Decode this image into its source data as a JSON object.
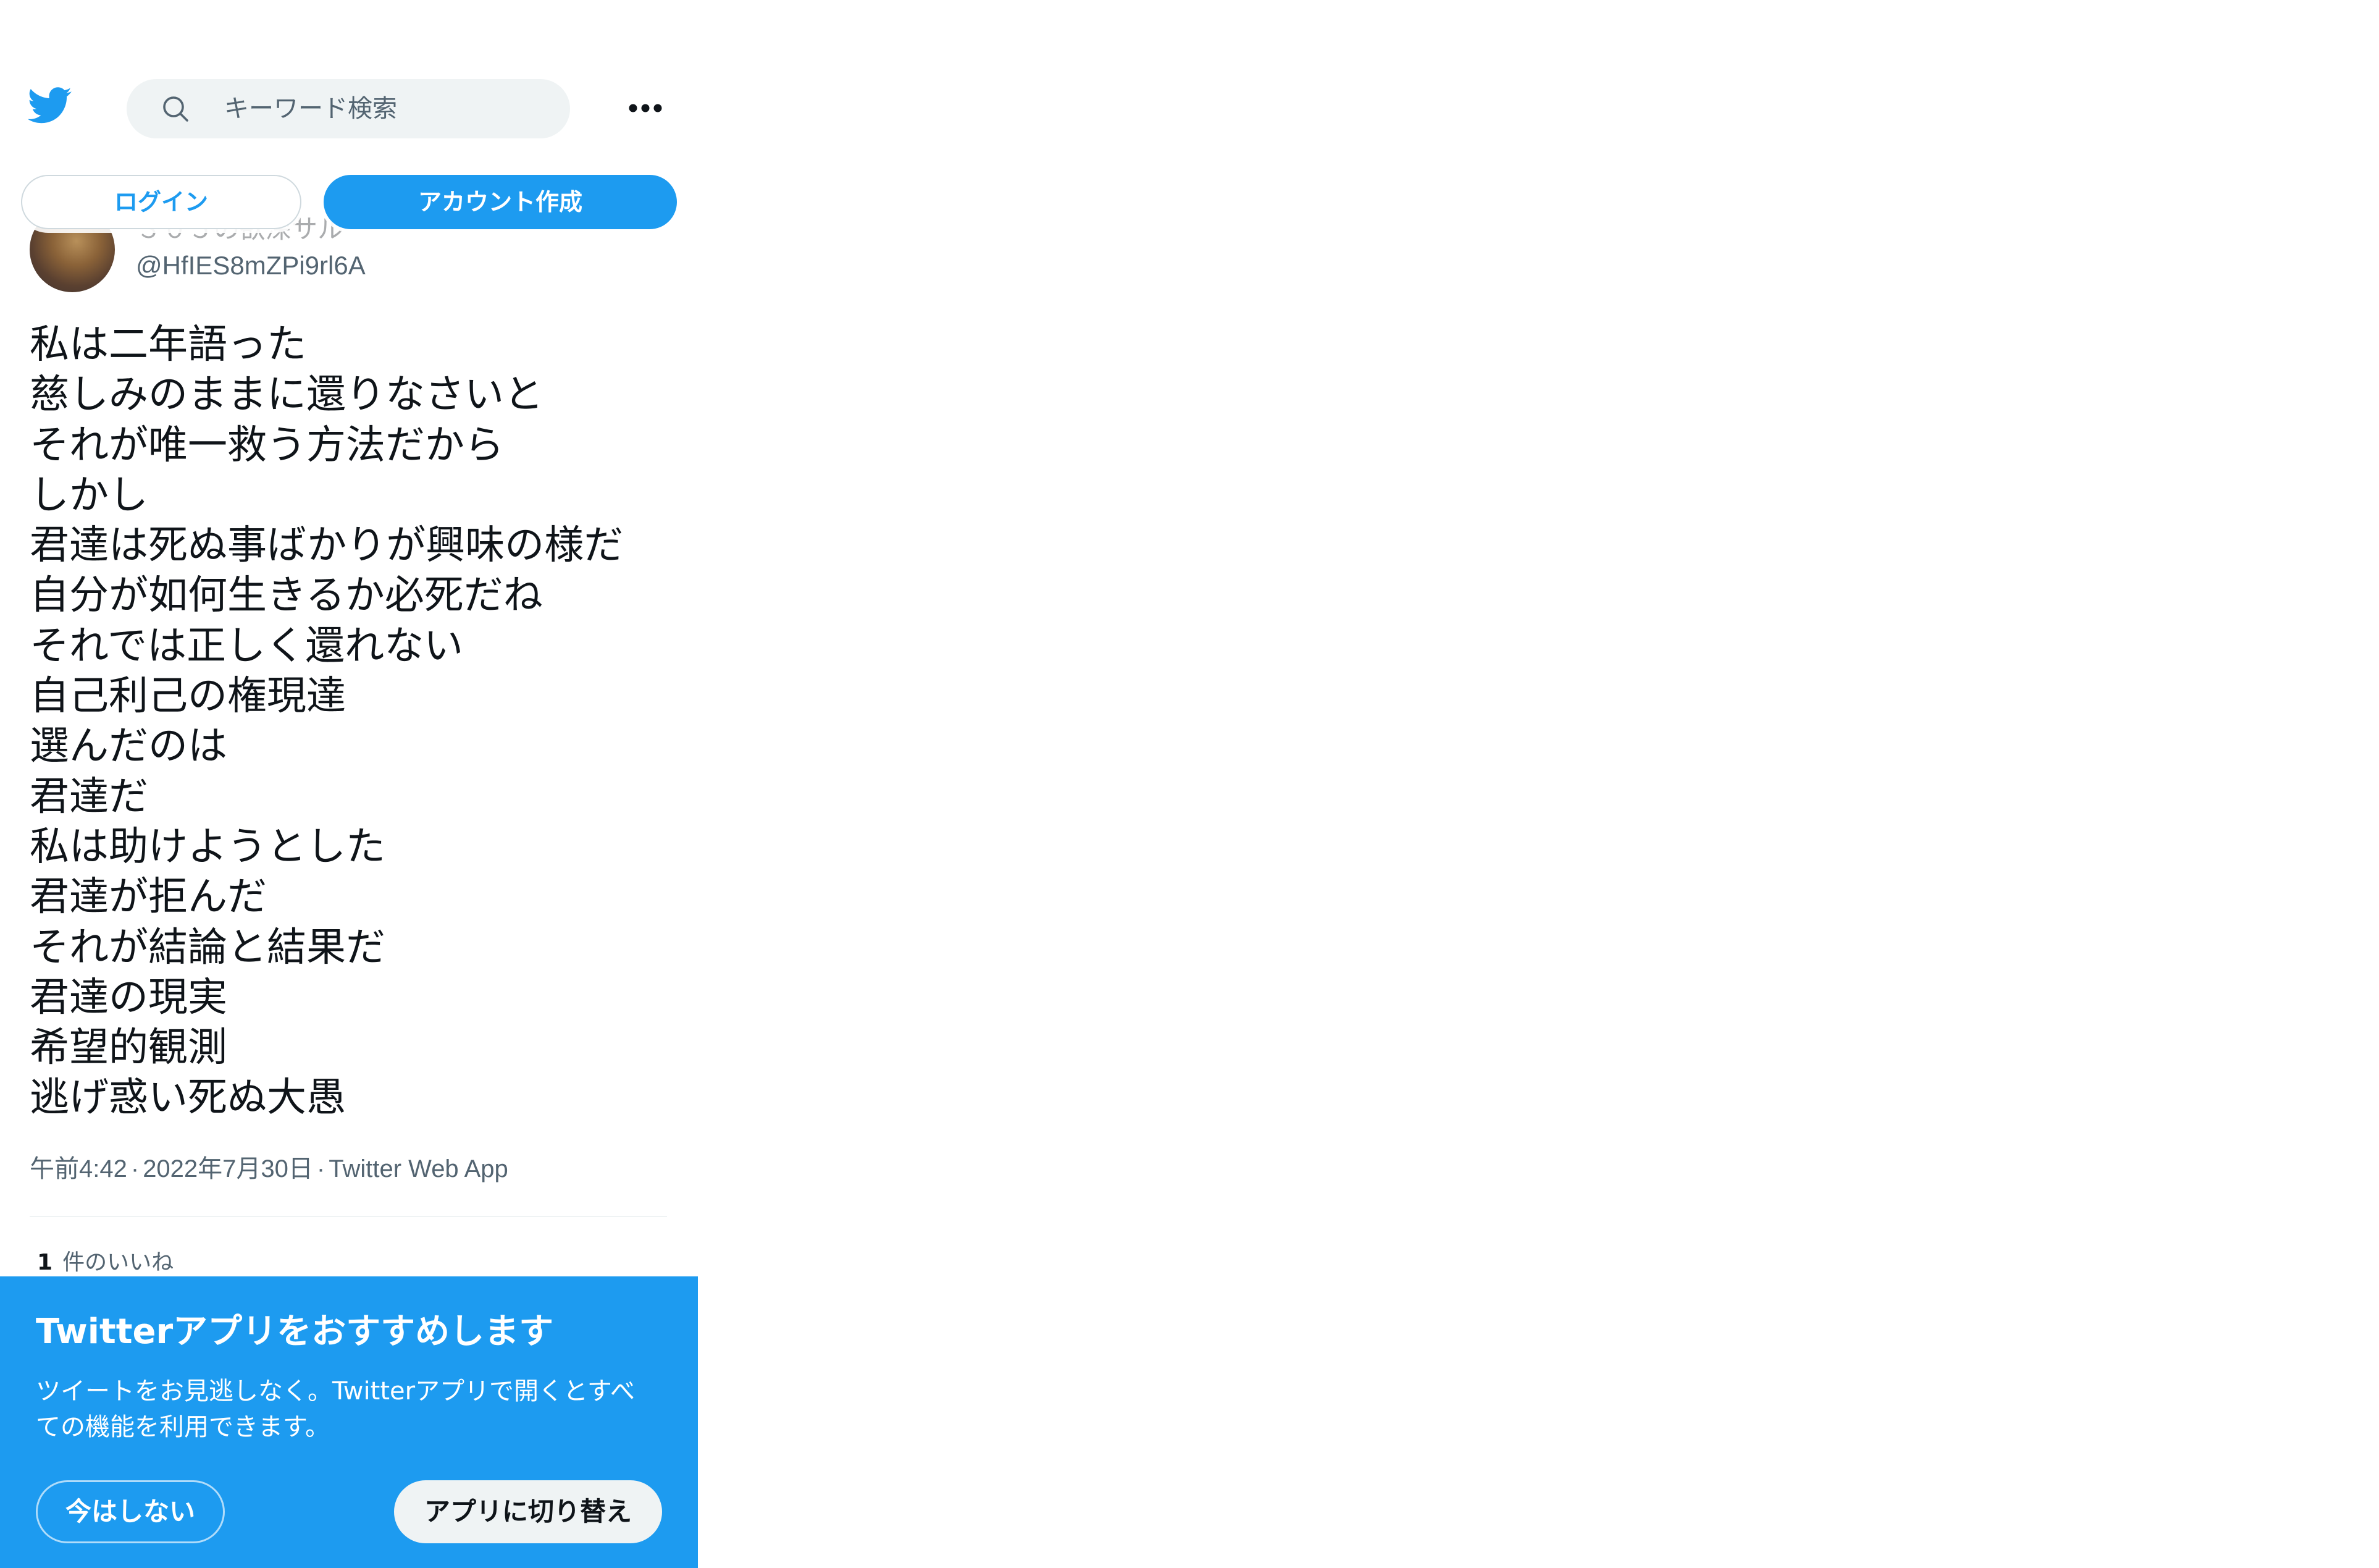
{
  "colors": {
    "brand_blue": "#1d9bf0",
    "text_primary": "#0f1419",
    "text_secondary": "#536471",
    "search_bg": "#eff3f4"
  },
  "header": {
    "logo_icon": "twitter-bird-icon",
    "search": {
      "icon": "search-icon",
      "placeholder": "キーワード検索"
    },
    "more_icon": "more-horizontal-icon"
  },
  "auth": {
    "login_label": "ログイン",
    "signup_label": "アカウント作成"
  },
  "tweet": {
    "author": {
      "display_name": "３０５の欲深サル",
      "handle": "@HfIES8mZPi9rl6A"
    },
    "lines": [
      "私は二年語った",
      "慈しみのままに還りなさいと",
      "それが唯一救う方法だから",
      "しかし",
      "君達は死ぬ事ばかりが興味の様だ",
      "自分が如何生きるか必死だね",
      "それでは正しく還れない",
      "自己利己の権現達",
      "選んだのは",
      "君達だ",
      "私は助けようとした",
      "君達が拒んだ",
      "それが結論と結果だ",
      "君達の現実",
      "希望的観測",
      "逃げ惑い死ぬ大愚"
    ],
    "meta": {
      "time": "午前4:42",
      "date": "2022年7月30日",
      "source": "Twitter Web App",
      "separator": "·"
    },
    "likes": {
      "count": "1",
      "label": "件のいいね"
    }
  },
  "promo": {
    "title": "Twitterアプリをおすすめします",
    "body_lines": [
      "ツイートをお見逃しなく。Twitterアプリで開くとすべ",
      "ての機能を利用できます。"
    ],
    "dismiss_label": "今はしない",
    "switch_label": "アプリに切り替え"
  }
}
